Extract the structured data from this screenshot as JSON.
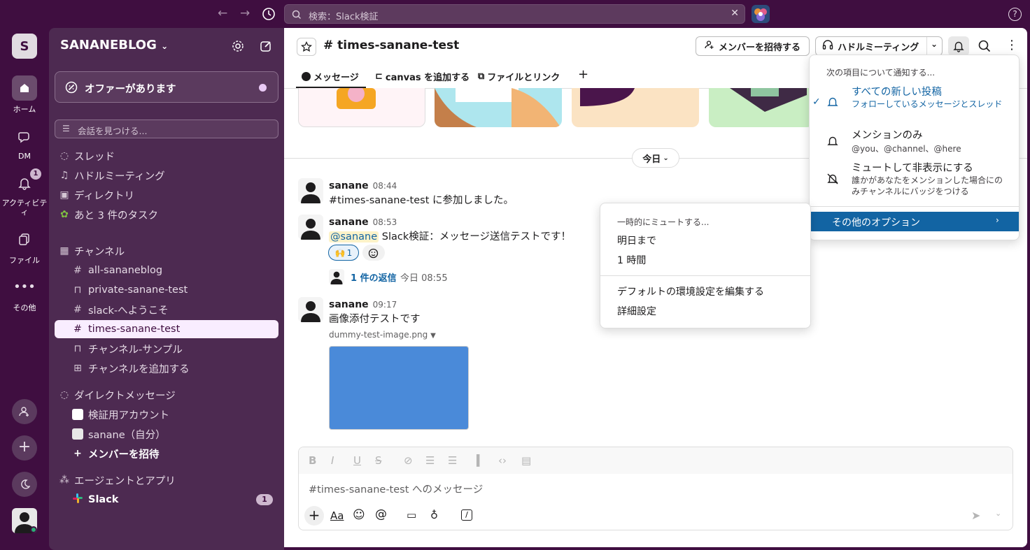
{
  "topbar": {
    "back": "←",
    "forward": "→",
    "history_icon": "clock-icon",
    "search_text": "検索：Slack検証",
    "clear": "✕",
    "help": "?"
  },
  "workspace": {
    "initial": "S",
    "name": "SANANEBLOG"
  },
  "rail": [
    {
      "label": "ホーム",
      "icon": "home-icon"
    },
    {
      "label": "DM",
      "icon": "dm-icon"
    },
    {
      "label": "アクティビティ",
      "icon": "bell-icon",
      "badge": "1"
    },
    {
      "label": "ファイル",
      "icon": "files-icon"
    },
    {
      "label": "その他",
      "icon": "more-icon"
    }
  ],
  "sidebar": {
    "offer": "オファーがあります",
    "find_placeholder": "会話を見つける...",
    "nav": [
      "スレッド",
      "ハドルミーティング",
      "ディレクトリ",
      "あと 3 件のタスク"
    ],
    "channels_header": "チャンネル",
    "channels": [
      "all-sananeblog",
      "private-sanane-test",
      "slack-へようこそ",
      "times-sanane-test",
      "チャンネル-サンプル",
      "チャンネルを追加する"
    ],
    "dm_header": "ダイレクトメッセージ",
    "dms": [
      "検証用アカウント",
      "sanane（自分）",
      "メンバーを招待"
    ],
    "apps_header": "エージェントとアプリ",
    "apps": [
      {
        "name": "Slack",
        "badge": "1"
      }
    ]
  },
  "channel": {
    "title": "# times-sanane-test",
    "invite_button": "メンバーを招待する",
    "huddle_button": "ハドルミーティング",
    "tabs": [
      "メッセージ",
      "canvas を追加する",
      "ファイルとリンク",
      "+"
    ]
  },
  "divider": {
    "label": "今日"
  },
  "messages": [
    {
      "user": "sanane",
      "time": "08:44",
      "text": "#times-sanane-test に参加しました。"
    },
    {
      "user": "sanane",
      "time": "08:53",
      "mention": "@sanane",
      "text": " Slack検証：メッセージ送信テストです！",
      "reaction": "🙌",
      "reaction_count": "1",
      "replies": "1 件の返信",
      "reply_time": "今日 08:55"
    },
    {
      "user": "sanane",
      "time": "09:17",
      "text": "画像添付テストです",
      "attachment": "dummy-test-image.png"
    }
  ],
  "composer": {
    "placeholder": "#times-sanane-test へのメッセージ",
    "aa": "Aa"
  },
  "notify_menu": {
    "header": "次の項目について通知する...",
    "items": [
      {
        "title": "すべての新しい投稿",
        "desc": "フォローしているメッセージとスレッド",
        "checked": "✓"
      },
      {
        "title": "メンションのみ",
        "desc": "@you、@channel、@here"
      },
      {
        "title": "ミュートして非表示にする",
        "desc": "誰かがあなたをメンションした場合にのみチャンネルにバッジをつける"
      }
    ],
    "more": "その他のオプション"
  },
  "mute_menu": {
    "header": "一時的にミュートする...",
    "items": [
      "明日まで",
      "1 時間"
    ],
    "items2": [
      "デフォルトの環境設定を編集する",
      "詳細設定"
    ]
  },
  "colors": {
    "aubergine": "#3f0e40",
    "sidebar": "#4d2a51",
    "link": "#1264a3",
    "active_menu": "#1264a3",
    "attachment": "#4a8ad9"
  }
}
